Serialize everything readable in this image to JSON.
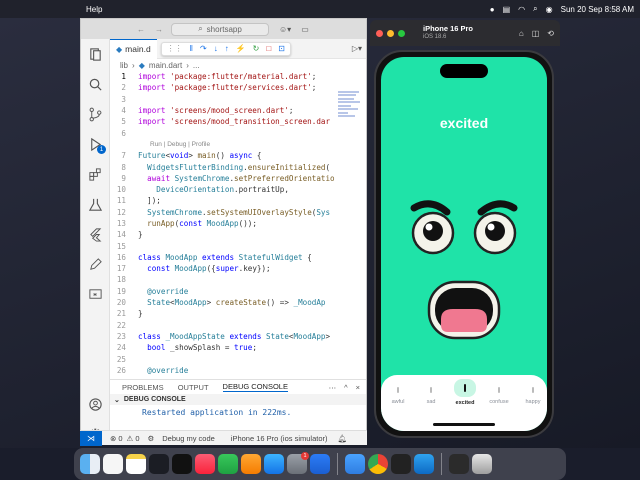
{
  "menubar": {
    "app_menu": "Help",
    "datetime": "Sun 20 Sep  8:58 AM"
  },
  "vscode": {
    "search_text": "shortsapp",
    "tab_label": "main.d",
    "breadcrumb": [
      "lib",
      "main.dart",
      "..."
    ],
    "codelens": "Run | Debug | Profile",
    "lines": [
      {
        "n": "1",
        "html": "<span class=\"kw2\">import</span> <span class=\"str\">'package:flutter/material.dart'</span>;"
      },
      {
        "n": "2",
        "html": "<span class=\"kw2\">import</span> <span class=\"str\">'package:flutter/services.dart'</span>;"
      },
      {
        "n": "3",
        "html": ""
      },
      {
        "n": "4",
        "html": "<span class=\"kw2\">import</span> <span class=\"str\">'screens/mood_screen.dart'</span>;"
      },
      {
        "n": "5",
        "html": "<span class=\"kw2\">import</span> <span class=\"str\">'screens/mood_transition_screen.dar</span>"
      },
      {
        "n": "6",
        "html": ""
      },
      {
        "n": "lens",
        "html": ""
      },
      {
        "n": "7",
        "html": "<span class=\"ty\">Future</span>&lt;<span class=\"kw\">void</span>&gt; <span class=\"fn\">main</span>() <span class=\"kw\">async</span> {"
      },
      {
        "n": "8",
        "html": "  <span class=\"ty\">WidgetsFlutterBinding</span>.<span class=\"fn\">ensureInitialized</span>("
      },
      {
        "n": "9",
        "html": "  <span class=\"kw2\">await</span> <span class=\"ty\">SystemChrome</span>.<span class=\"fn\">setPreferredOrientatio</span>"
      },
      {
        "n": "10",
        "html": "    <span class=\"ty\">DeviceOrientation</span>.portraitUp,"
      },
      {
        "n": "11",
        "html": "  ]);"
      },
      {
        "n": "12",
        "html": "  <span class=\"ty\">SystemChrome</span>.<span class=\"fn\">setSystemUIOverlayStyle</span>(<span class=\"ty\">Sys</span>"
      },
      {
        "n": "13",
        "html": "  <span class=\"fn\">runApp</span>(<span class=\"kw\">const</span> <span class=\"ty\">MoodApp</span>());"
      },
      {
        "n": "14",
        "html": "}"
      },
      {
        "n": "15",
        "html": ""
      },
      {
        "n": "16",
        "html": "<span class=\"kw\">class</span> <span class=\"ty\">MoodApp</span> <span class=\"kw\">extends</span> <span class=\"ty\">StatefulWidget</span> {"
      },
      {
        "n": "17",
        "html": "  <span class=\"kw\">const</span> <span class=\"ty\">MoodApp</span>({<span class=\"kw\">super</span>.key});"
      },
      {
        "n": "18",
        "html": ""
      },
      {
        "n": "19",
        "html": "  <span class=\"ty\">@override</span>"
      },
      {
        "n": "20",
        "html": "  <span class=\"ty\">State</span>&lt;<span class=\"ty\">MoodApp</span>&gt; <span class=\"fn\">createState</span>() =&gt; <span class=\"ty\">_MoodAp</span>"
      },
      {
        "n": "21",
        "html": "}"
      },
      {
        "n": "22",
        "html": ""
      },
      {
        "n": "23",
        "html": "<span class=\"kw\">class</span> <span class=\"ty\">_MoodAppState</span> <span class=\"kw\">extends</span> <span class=\"ty\">State</span>&lt;<span class=\"ty\">MoodApp</span>&gt;"
      },
      {
        "n": "24",
        "html": "  <span class=\"kw\">bool</span> _showSplash = <span class=\"kw\">true</span>;"
      },
      {
        "n": "25",
        "html": ""
      },
      {
        "n": "26",
        "html": "  <span class=\"ty\">@override</span>"
      }
    ],
    "panel_tabs": [
      "PROBLEMS",
      "OUTPUT",
      "DEBUG CONSOLE"
    ],
    "debug_console_title": "DEBUG CONSOLE",
    "console_output": "Restarted application in 222ms.",
    "console_prompt": ">",
    "status": {
      "errors": "0",
      "warnings": "0",
      "debug_mode": "Debug my code",
      "device": "iPhone 16 Pro (ios simulator)"
    }
  },
  "simulator": {
    "device_name": "iPhone 16 Pro",
    "os_version": "iOS 18.6",
    "mood_label": "excited",
    "background_color": "#1fe3a8",
    "nav_items": [
      {
        "label": "awful",
        "selected": false
      },
      {
        "label": "sad",
        "selected": false
      },
      {
        "label": "excited",
        "selected": true
      },
      {
        "label": "confuse",
        "selected": false
      },
      {
        "label": "happy",
        "selected": false
      }
    ],
    "selected_pill_color": "#c8f6e4"
  },
  "dock": {
    "apps": [
      "finder-icon",
      "reminders-icon",
      "notes-icon",
      "stocks-icon",
      "tv-icon",
      "music-icon",
      "numbers-icon",
      "pages-icon",
      "appstore-icon",
      "settings-icon",
      "quicktime-icon",
      "files-icon",
      "chrome-icon",
      "unity-icon",
      "vscode-icon",
      "screen-icon",
      "trash-icon"
    ],
    "settings_badge": "1"
  }
}
